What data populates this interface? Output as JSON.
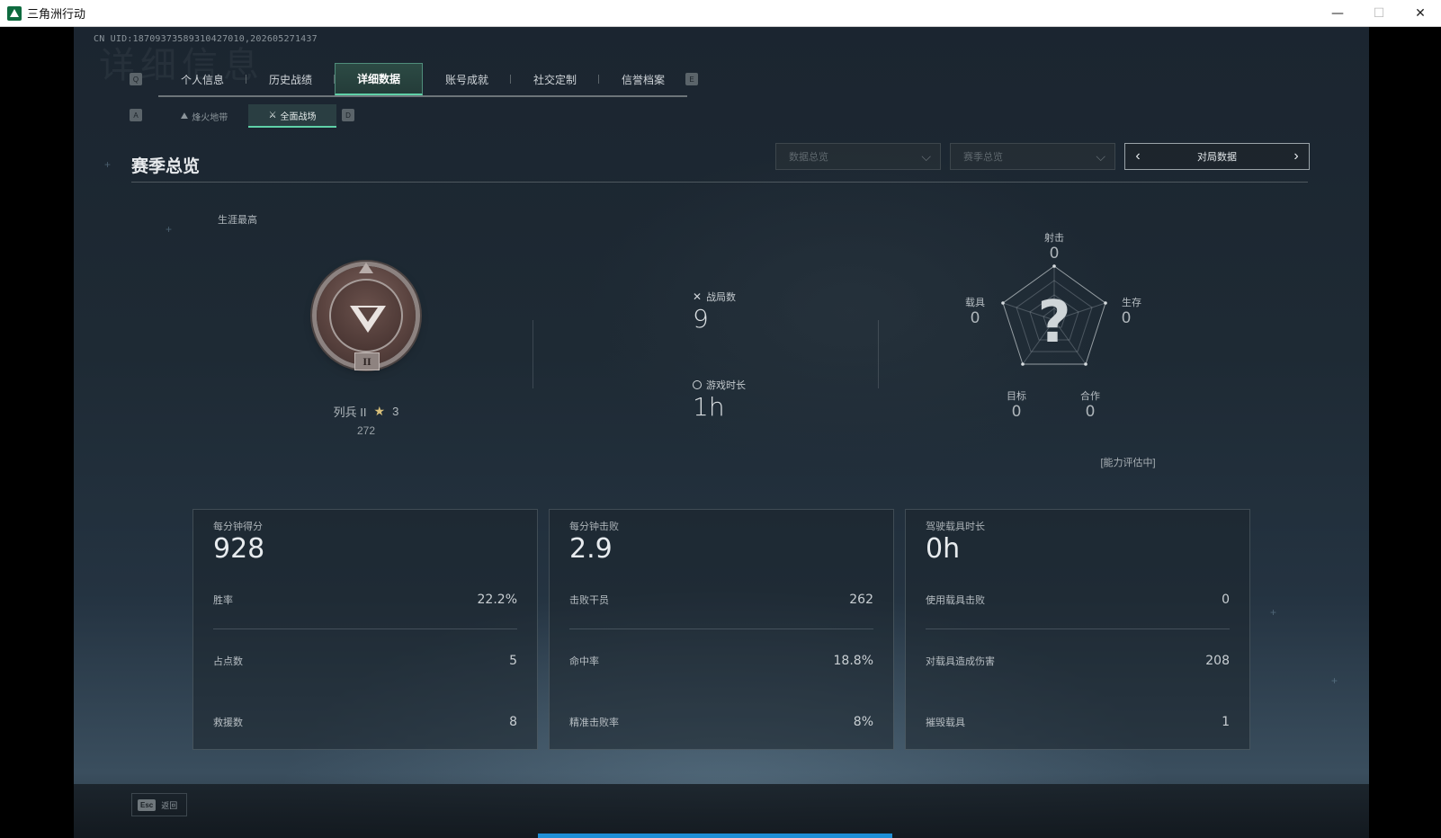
{
  "window": {
    "title": "三角洲行动",
    "controls": {
      "minimize": "—",
      "maximize": "☐",
      "close": "✕"
    }
  },
  "uid": "CN UID:1870937358931042701​0,202605271437",
  "nav": {
    "key_prev": "Q",
    "key_next": "E",
    "tabs": [
      {
        "label": "个人信息",
        "active": false
      },
      {
        "label": "历史战绩",
        "active": false
      },
      {
        "label": "详细数据",
        "active": true
      },
      {
        "label": "账号成就",
        "active": false
      },
      {
        "label": "社交定制",
        "active": false
      },
      {
        "label": "信誉档案",
        "active": false
      }
    ]
  },
  "subnav": {
    "key_prev": "A",
    "key_next": "D",
    "tabs": [
      {
        "label": "烽火地带",
        "icon": "mountain-icon",
        "active": false
      },
      {
        "label": "全面战场",
        "icon": "battlefield-icon",
        "active": true
      }
    ]
  },
  "section": {
    "title": "赛季总览",
    "dropdown_1": "数据总览",
    "dropdown_2": "赛季总览",
    "switcher_label": "对局数据"
  },
  "career": {
    "label": "生涯最高",
    "rank_name": "列兵 II",
    "stars": "3",
    "score": "272",
    "medal_roman": "II"
  },
  "summary": {
    "matches_label": "战局数",
    "matches_value": "9",
    "playtime_label": "游戏时长",
    "playtime_value": "1h"
  },
  "radar": {
    "axes": [
      {
        "label": "射击",
        "value": "0"
      },
      {
        "label": "生存",
        "value": "0"
      },
      {
        "label": "合作",
        "value": "0"
      },
      {
        "label": "目标",
        "value": "0"
      },
      {
        "label": "载具",
        "value": "0"
      }
    ],
    "center_mark": "?",
    "status": "[能力评估中]"
  },
  "panels": [
    {
      "header": "每分钟得分",
      "big": "928",
      "rows": [
        {
          "k": "胜率",
          "v": "22.2%"
        },
        {
          "k": "占点数",
          "v": "5"
        },
        {
          "k": "救援数",
          "v": "8"
        }
      ]
    },
    {
      "header": "每分钟击败",
      "big": "2.9",
      "rows": [
        {
          "k": "击败干员",
          "v": "262"
        },
        {
          "k": "命中率",
          "v": "18.8%"
        },
        {
          "k": "精准击败率",
          "v": "8%"
        }
      ]
    },
    {
      "header": "驾驶载具时长",
      "big": "0h",
      "rows": [
        {
          "k": "使用载具击败",
          "v": "0"
        },
        {
          "k": "对载具造成伤害",
          "v": "208"
        },
        {
          "k": "摧毁载具",
          "v": "1"
        }
      ]
    }
  ],
  "footer": {
    "esc_key": "Esc",
    "back_label": "返回"
  },
  "colors": {
    "accent": "#5fd1a8",
    "progress": "#1f8fd6"
  }
}
